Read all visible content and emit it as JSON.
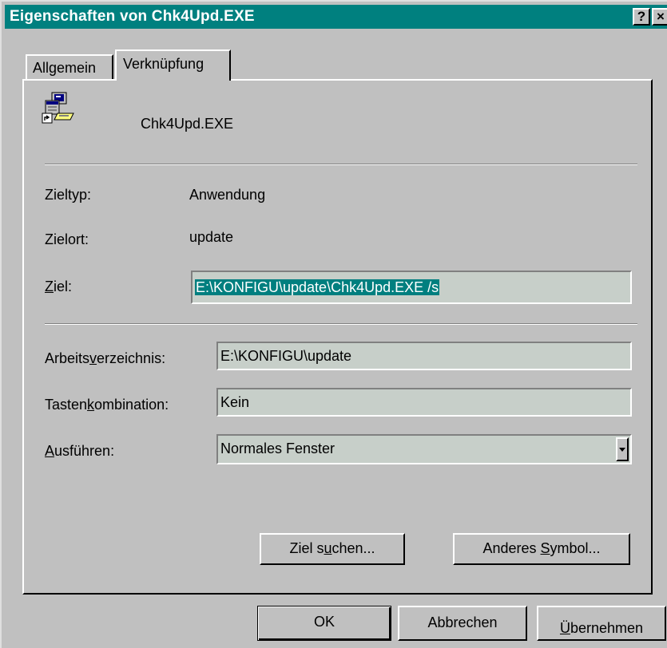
{
  "window": {
    "title": "Eigenschaften von Chk4Upd.EXE",
    "help_button": "?",
    "close_button": "×"
  },
  "tabs": [
    {
      "label": "Allgemein",
      "active": false
    },
    {
      "label": "Verknüpfung",
      "active": true
    }
  ],
  "shortcut": {
    "icon": "program-shortcut-icon",
    "filename": "Chk4Upd.EXE",
    "zieltyp_label": "Zieltyp:",
    "zieltyp_value": "Anwendung",
    "zielort_label": "Zielort:",
    "zielort_value": "update",
    "ziel_label_accel": "Z",
    "ziel_label_rest": "iel:",
    "ziel_value": "E:\\KONFIGU\\update\\Chk4Upd.EXE /s",
    "arbeits_label_pre": "Arbeits",
    "arbeits_label_accel": "v",
    "arbeits_label_post": "erzeichnis:",
    "arbeits_value": "E:\\KONFIGU\\update",
    "tasten_label_pre": "Tasten",
    "tasten_label_accel": "k",
    "tasten_label_post": "ombination:",
    "tasten_value": "Kein",
    "ausf_label_accel": "A",
    "ausf_label_rest": "usführen:",
    "ausf_value": "Normales Fenster"
  },
  "buttons": {
    "ziel_suchen_pre": "Ziel s",
    "ziel_suchen_accel": "u",
    "ziel_suchen_post": "chen...",
    "anderes_pre": "Anderes ",
    "anderes_accel": "S",
    "anderes_post": "ymbol...",
    "ok": "OK",
    "abbrechen": "Abbrechen",
    "uebernehmen_accel": "Ü",
    "uebernehmen_rest": "bernehmen"
  },
  "colors": {
    "titlebar": "#00807f",
    "selection": "#007f7f",
    "face": "#c0c0c0",
    "field_bg": "#c7cfc9"
  }
}
